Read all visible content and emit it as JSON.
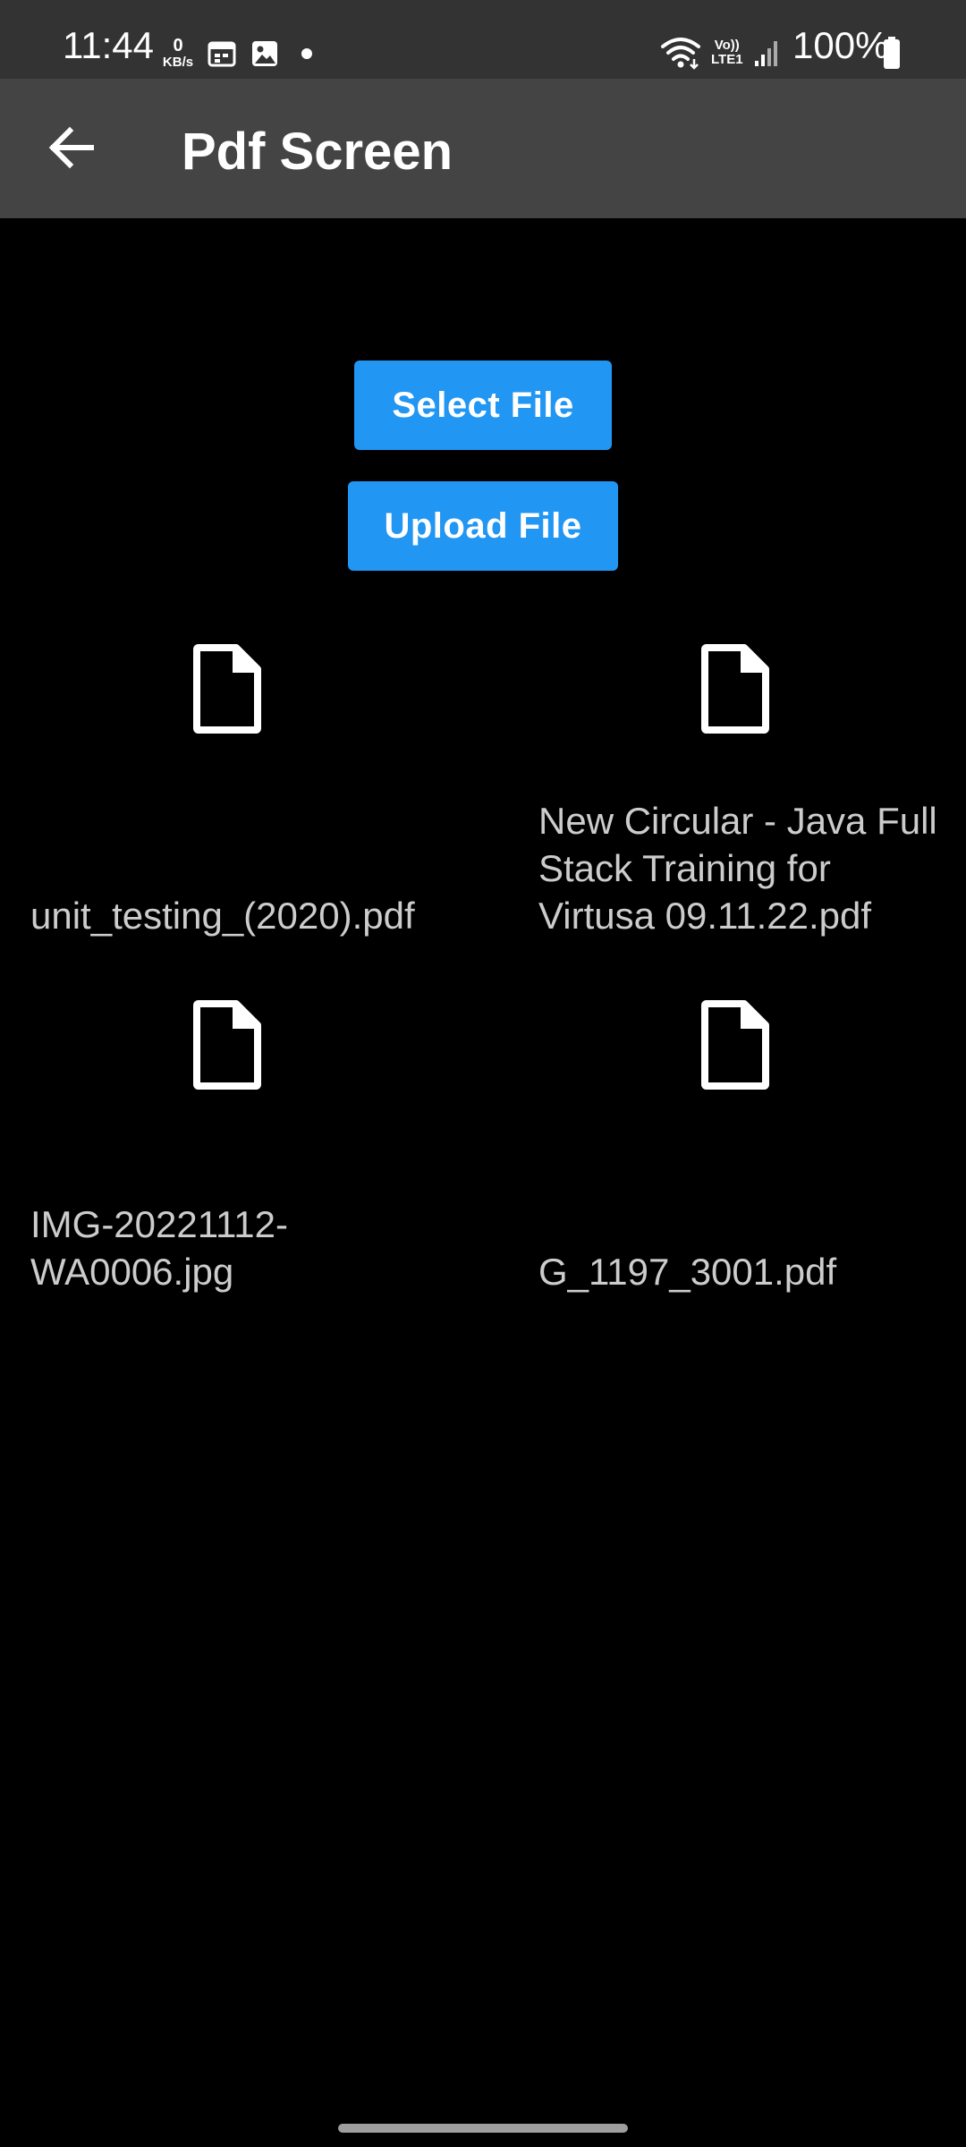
{
  "status_bar": {
    "time": "11:44",
    "net_speed_value": "0",
    "net_speed_unit": "KB/s",
    "lte_top": "Vo))",
    "lte_bottom": "LTE1",
    "battery": "100%",
    "icons": [
      "calendar-icon",
      "gallery-icon",
      "dot-icon",
      "wifi-icon",
      "signal-icon",
      "battery-icon"
    ]
  },
  "app_bar": {
    "title": "Pdf Screen",
    "back_icon": "arrow-back-icon"
  },
  "actions": {
    "select_label": "Select File",
    "upload_label": "Upload File",
    "button_color": "#2196f3"
  },
  "files": [
    {
      "name": "unit_testing_(2020).pdf",
      "icon": "file-icon"
    },
    {
      "name": "New Circular - Java Full Stack Training for Virtusa 09.11.22.pdf",
      "icon": "file-icon"
    },
    {
      "name": "IMG-20221112-WA0006.jpg",
      "icon": "file-icon"
    },
    {
      "name": "G_1197_3001.pdf",
      "icon": "file-icon"
    }
  ]
}
